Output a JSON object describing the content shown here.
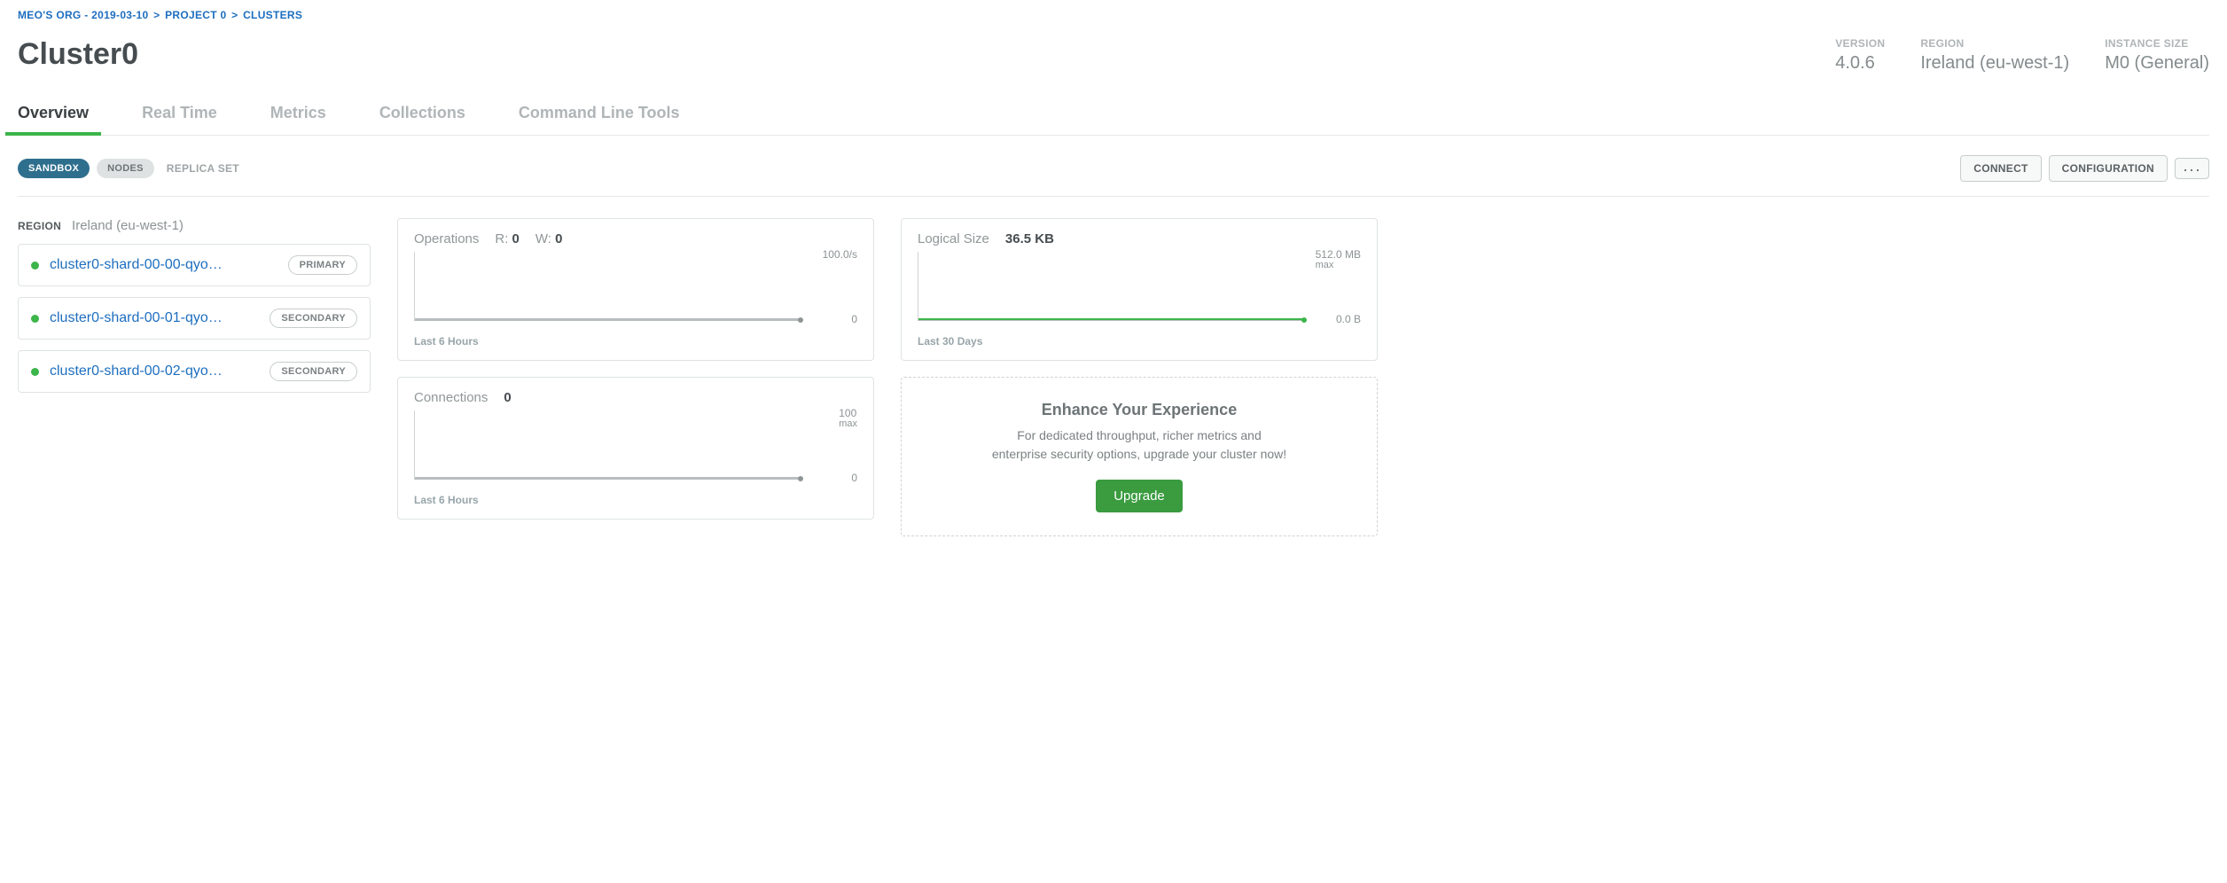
{
  "breadcrumb": [
    {
      "label": "MEO'S ORG - 2019-03-10"
    },
    {
      "label": "PROJECT 0"
    },
    {
      "label": "CLUSTERS"
    }
  ],
  "title": "Cluster0",
  "meta": {
    "version": {
      "label": "VERSION",
      "value": "4.0.6"
    },
    "region": {
      "label": "REGION",
      "value": "Ireland (eu-west-1)"
    },
    "size": {
      "label": "INSTANCE SIZE",
      "value": "M0 (General)"
    }
  },
  "tabs": [
    {
      "label": "Overview",
      "active": true
    },
    {
      "label": "Real Time"
    },
    {
      "label": "Metrics"
    },
    {
      "label": "Collections"
    },
    {
      "label": "Command Line Tools"
    }
  ],
  "badges": {
    "sandbox": "SANDBOX",
    "nodes": "NODES",
    "replica": "REPLICA SET"
  },
  "buttons": {
    "connect": "CONNECT",
    "configuration": "CONFIGURATION"
  },
  "region_section": {
    "label": "REGION",
    "value": "Ireland (eu-west-1)",
    "shards": [
      {
        "name": "cluster0-shard-00-00-qyo…",
        "role": "PRIMARY"
      },
      {
        "name": "cluster0-shard-00-01-qyo…",
        "role": "SECONDARY"
      },
      {
        "name": "cluster0-shard-00-02-qyo…",
        "role": "SECONDARY"
      }
    ]
  },
  "charts": {
    "operations": {
      "title": "Operations",
      "r_label": "R:",
      "r_value": "0",
      "w_label": "W:",
      "w_value": "0",
      "axis_top": "100.0/s",
      "axis_bot": "0",
      "footer": "Last 6 Hours"
    },
    "connections": {
      "title": "Connections",
      "value": "0",
      "axis_top": "100",
      "axis_top_sub": "max",
      "axis_bot": "0",
      "footer": "Last 6 Hours"
    },
    "logical_size": {
      "title": "Logical Size",
      "value": "36.5 KB",
      "axis_top": "512.0 MB",
      "axis_top_sub": "max",
      "axis_bot": "0.0 B",
      "footer": "Last 30 Days"
    }
  },
  "promo": {
    "title": "Enhance Your Experience",
    "text_line1": "For dedicated throughput, richer metrics and",
    "text_line2": "enterprise security options, upgrade your cluster now!",
    "button": "Upgrade"
  },
  "chart_data": [
    {
      "type": "line",
      "title": "Operations",
      "series": [
        {
          "name": "R",
          "values": [
            0
          ]
        },
        {
          "name": "W",
          "values": [
            0
          ]
        }
      ],
      "ylim": [
        0,
        100
      ],
      "ylabel": "ops/s",
      "range": "Last 6 Hours"
    },
    {
      "type": "line",
      "title": "Connections",
      "values": [
        0
      ],
      "ylim": [
        0,
        100
      ],
      "ylabel": "connections",
      "range": "Last 6 Hours"
    },
    {
      "type": "line",
      "title": "Logical Size",
      "values": [
        36500
      ],
      "current_display": "36.5 KB",
      "ylim_display": [
        "0.0 B",
        "512.0 MB"
      ],
      "range": "Last 30 Days"
    }
  ]
}
